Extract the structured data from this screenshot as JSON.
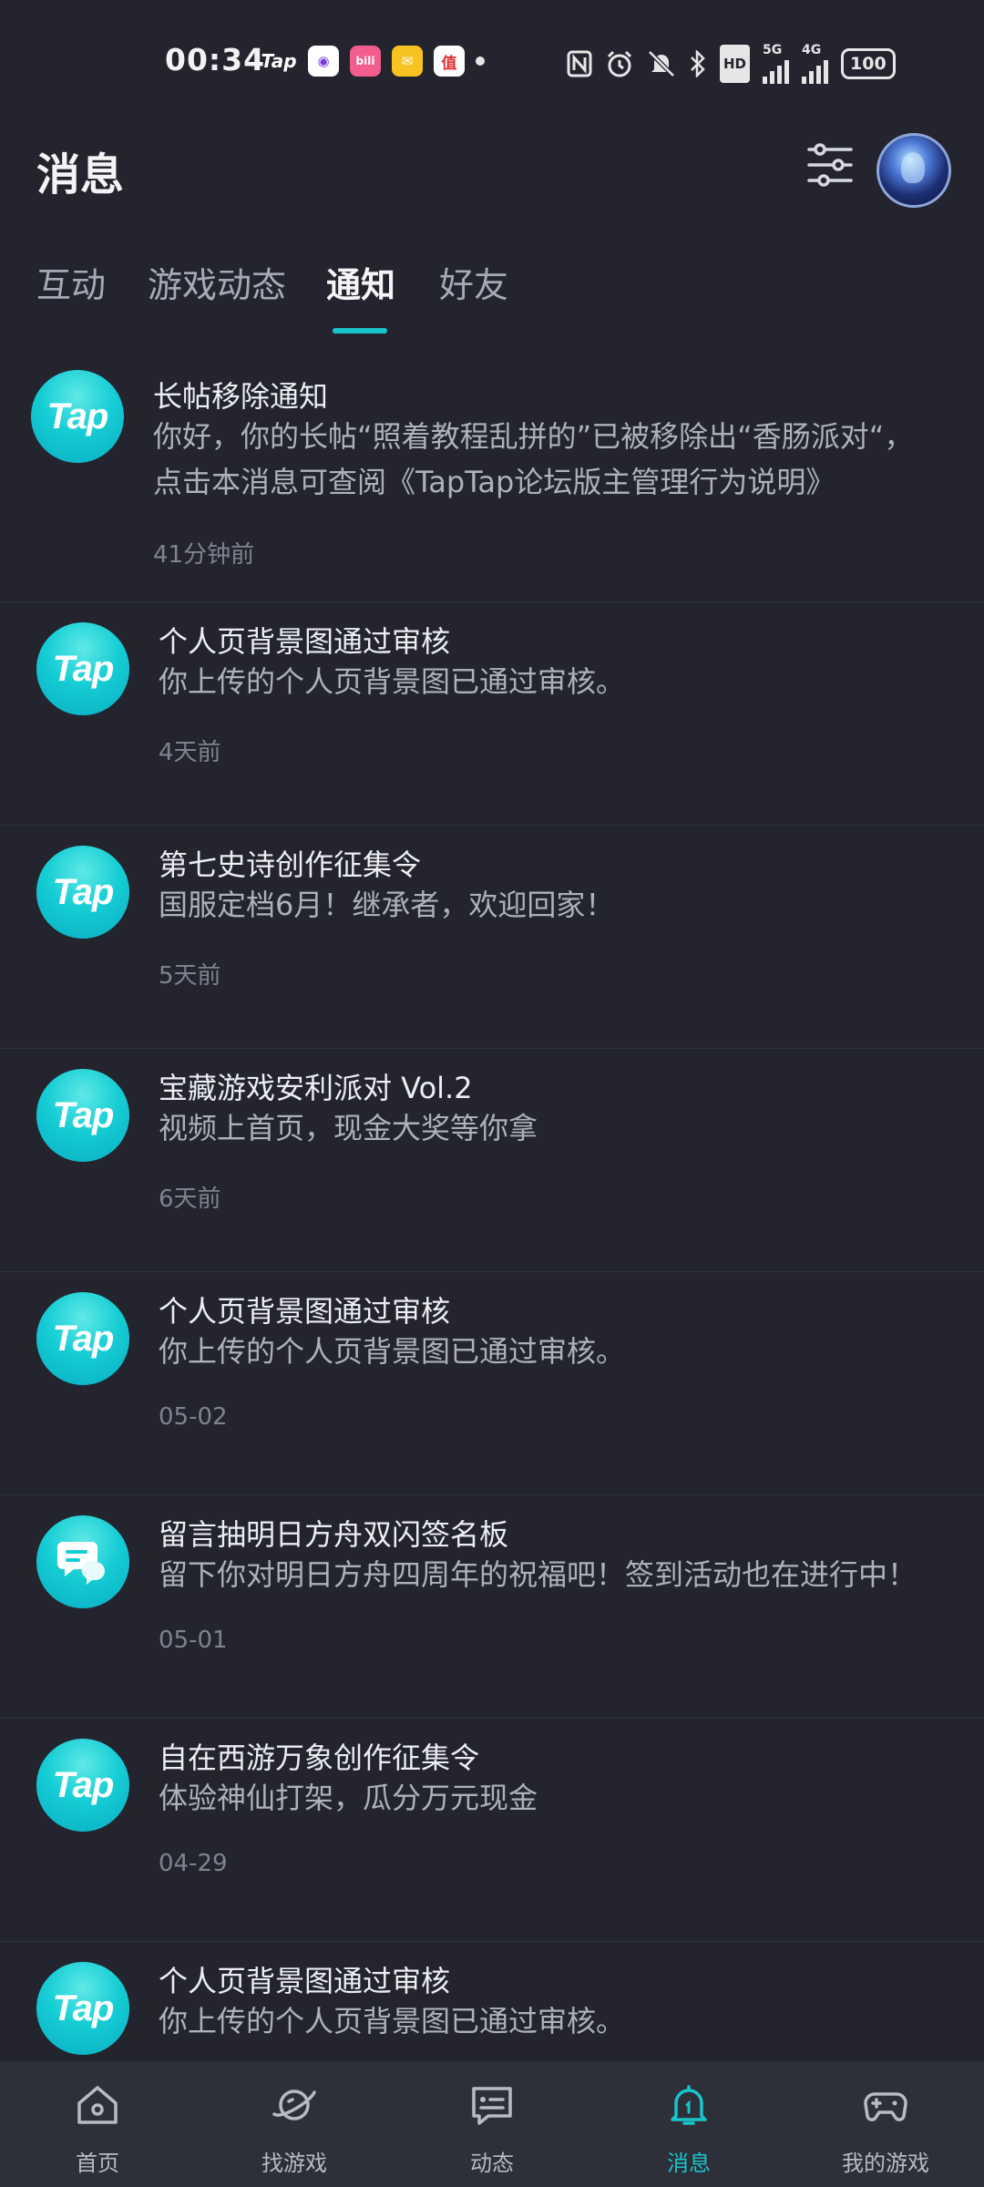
{
  "status_bar": {
    "time": "00:34",
    "app_icons": [
      "Tap",
      "",
      "bili",
      "",
      "值"
    ],
    "battery": "100",
    "net_5g": "5G",
    "net_4g": "4G",
    "hd": "HD"
  },
  "header": {
    "title": "消息"
  },
  "tabs": [
    {
      "label": "互动"
    },
    {
      "label": "游戏动态"
    },
    {
      "label": "通知"
    },
    {
      "label": "好友"
    }
  ],
  "active_tab": "通知",
  "notifications": [
    {
      "icon": "Tap",
      "title": "长帖移除通知",
      "body": "你好，你的长帖“照着教程乱拼的”已被移除出“香肠派对“，点击本消息可查阅《TapTap论坛版主管理行为说明》",
      "time": "41分钟前"
    },
    {
      "icon": "Tap",
      "title": "个人页背景图通过审核",
      "body": "你上传的个人页背景图已通过审核。",
      "time": "4天前"
    },
    {
      "icon": "Tap",
      "title": "第七史诗创作征集令",
      "body": "国服定档6月！继承者，欢迎回家！",
      "time": "5天前"
    },
    {
      "icon": "Tap",
      "title": "宝藏游戏安利派对 Vol.2",
      "body": "视频上首页，现金大奖等你拿",
      "time": "6天前"
    },
    {
      "icon": "Tap",
      "title": "个人页背景图通过审核",
      "body": "你上传的个人页背景图已通过审核。",
      "time": "05-02"
    },
    {
      "icon": "chat-bubble",
      "title": "留言抽明日方舟双闪签名板",
      "body": "留下你对明日方舟四周年的祝福吧！签到活动也在进行中！",
      "time": "05-01"
    },
    {
      "icon": "Tap",
      "title": "自在西游万象创作征集令",
      "body": "体验神仙打架，瓜分万元现金",
      "time": "04-29"
    },
    {
      "icon": "Tap",
      "title": "个人页背景图通过审核",
      "body": "你上传的个人页背景图已通过审核。",
      "time": ""
    }
  ],
  "bottom_nav": [
    {
      "label": "首页",
      "icon": "home-icon"
    },
    {
      "label": "找游戏",
      "icon": "planet-icon"
    },
    {
      "label": "动态",
      "icon": "feed-icon"
    },
    {
      "label": "消息",
      "icon": "bell-icon"
    },
    {
      "label": "我的游戏",
      "icon": "gamepad-icon"
    }
  ],
  "colors": {
    "background": "#23242e",
    "accent": "#19c5c9",
    "nav_background": "#2d2f39"
  }
}
